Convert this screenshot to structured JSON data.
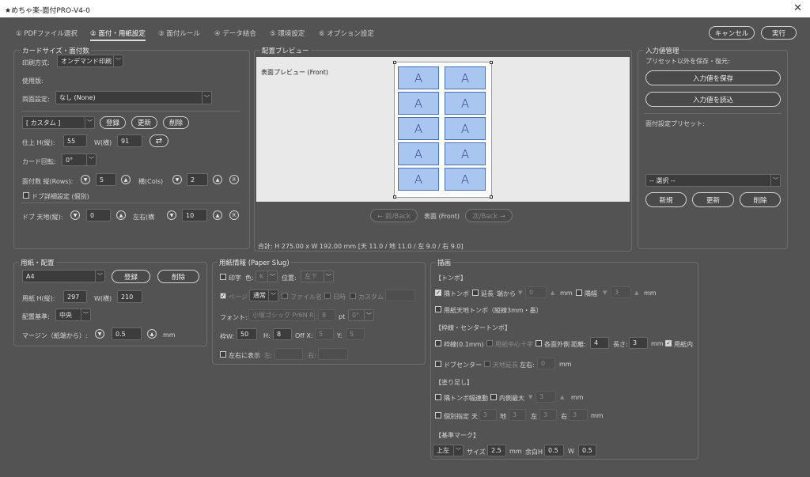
{
  "window": {
    "title": "★めちゃ楽-面付PRO-V4-0",
    "close": "✕"
  },
  "tabs": [
    {
      "label": "① PDFファイル選択"
    },
    {
      "label": "② 面付・用紙設定"
    },
    {
      "label": "③ 面付ルール"
    },
    {
      "label": "④ データ結合"
    },
    {
      "label": "⑤ 環境設定"
    },
    {
      "label": "⑥ オプション設定"
    }
  ],
  "actions": {
    "cancel": "キャンセル",
    "run": "実行"
  },
  "card_size": {
    "title": "カードサイズ・面付数",
    "print_method_label": "印刷方式:",
    "print_method_value": "オンデマンド印刷",
    "used_plate_label": "使用版:",
    "duplex_label": "両面設定:",
    "duplex_value": "なし (None)",
    "preset_value": "[ カスタム ]",
    "register": "登録",
    "update": "更新",
    "delete": "削除",
    "finish_label": "仕上 H(縦):",
    "finish_h": "55",
    "w_label": "W(横)",
    "finish_w": "91",
    "rotate_label": "カード回転:",
    "rotate_value": "0°",
    "count_label": "面付数 縦(Rows):",
    "rows": "5",
    "cols_label": "横(Cols)",
    "cols": "2",
    "reset": "R",
    "bleed_detail_label": "ドブ詳細設定 (個別)",
    "bleed_label": "ドブ 天地(縦):",
    "bleed_v": "0",
    "bleed_h_label": "左右(横",
    "bleed_h": "10"
  },
  "preview": {
    "title": "配置プレビュー",
    "label": "表面プレビュー (Front)",
    "card_letter": "A",
    "prev": "← 前/Back",
    "side": "表面 (Front)",
    "next": "次/Back →",
    "total": "合計: H 275.00 x W 192.00 mm  [天 11.0 / 地 11.0 / 左 9.0 / 右 9.0]"
  },
  "input_mgmt": {
    "title": "入力値管理",
    "subtitle": "プリセット以外を保存・復元:",
    "save": "入力値を保存",
    "load": "入力値を読込",
    "preset_label": "面付設定プリセット:",
    "select_value": "-- 選択 --",
    "new": "新規",
    "update": "更新",
    "delete": "削除"
  },
  "paper": {
    "title": "用紙・配置",
    "size_value": "A4",
    "register": "登録",
    "delete": "削除",
    "h_label": "用紙 H(縦):",
    "h": "297",
    "w_label": "W(横)",
    "w": "210",
    "base_label": "配置基準:",
    "base_value": "中央",
    "margin_label": "マージン（紙端から）:",
    "margin": "0.5",
    "unit": "mm"
  },
  "slug": {
    "title": "用紙情報 (Paper Slug)",
    "print_label": "印字",
    "color_label": "色:",
    "color_value": "K",
    "pos_label": "位置:",
    "pos_value": "左下",
    "page_label": "ページ",
    "mode_value": "通常",
    "filename_label": "ファイル名",
    "datetime_label": "日時",
    "custom_label": "カスタム",
    "font_label": "フォント:",
    "font_value": "小塚ゴシック Pr6N R",
    "font_size": "8",
    "pt": "pt",
    "angle_value": "0°",
    "frame_w_label": "枠W:",
    "frame_w": "50",
    "frame_h_label": "H:",
    "frame_h": "8",
    "off_x_label": "Off X:",
    "off_x": "5",
    "y_label": "Y:",
    "y": "5",
    "lr_label": "左右に表示",
    "left_label": "左:",
    "right_label": "右:"
  },
  "draw": {
    "title": "描画",
    "tombo_section": "【トンボ】",
    "corner_tombo": "隅トンボ",
    "extend": "延長",
    "from_edge": "端から",
    "extend_val": "0",
    "mm": "mm",
    "corner_width": "隅幅",
    "corner_width_val": "3",
    "paper_tombo": "用紙天地トンボ（縦線3mm・墨）",
    "frame_section": "【枠線・センタートンボ】",
    "frame_line": "枠線(0.1mm)",
    "paper_center": "用紙中心十字",
    "each_outside": "各面外側",
    "distance_label": "距離:",
    "distance": "4",
    "length_label": "長さ:",
    "length": "3",
    "in_paper": "用紙内",
    "bleed_center": "ドブセンター",
    "ext_vert": "天地延長",
    "lr_label": "左右:",
    "lr_val": "0",
    "fill_section": "【塗り足し】",
    "tombo_link": "隅トンボ幅連動",
    "inner_max": "内側最大",
    "inner_val": "3",
    "individual": "個別指定",
    "ten": "天",
    "ten_val": "3",
    "chi": "地",
    "chi_val": "3",
    "hidari": "左",
    "hidari_val": "3",
    "migi": "右",
    "migi_val": "3",
    "mark_section": "【基準マーク】",
    "mark_pos": "上左",
    "size_label": "サイズ",
    "size_val": "2.5",
    "margin_h_label": "余白H",
    "margin_h": "0.5",
    "w_label": "W",
    "w_val": "0.5"
  }
}
